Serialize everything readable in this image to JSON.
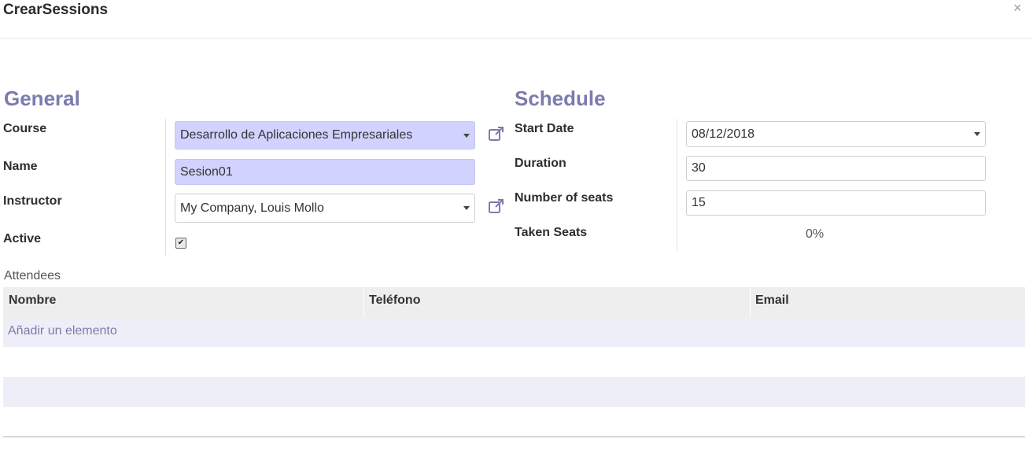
{
  "dialog": {
    "title": "CrearSessions",
    "close": "×"
  },
  "general": {
    "heading": "General",
    "course_label": "Course",
    "course_value": "Desarrollo de Aplicaciones Empresariales",
    "name_label": "Name",
    "name_value": "Sesion01",
    "instructor_label": "Instructor",
    "instructor_value": "My Company, Louis Mollo",
    "active_label": "Active",
    "active_checked": true
  },
  "schedule": {
    "heading": "Schedule",
    "start_date_label": "Start Date",
    "start_date_value": "08/12/2018",
    "duration_label": "Duration",
    "duration_value": "30",
    "seats_label": "Number of seats",
    "seats_value": "15",
    "taken_label": "Taken Seats",
    "taken_value": "0%"
  },
  "attendees": {
    "label": "Attendees",
    "columns": [
      "Nombre",
      "Teléfono",
      "Email"
    ],
    "add_item": "Añadir un elemento"
  },
  "colors": {
    "accent": "#7c7bad",
    "required_bg": "#d2d2ff"
  },
  "icons": {
    "external": "external-link-icon",
    "close": "close-icon"
  }
}
